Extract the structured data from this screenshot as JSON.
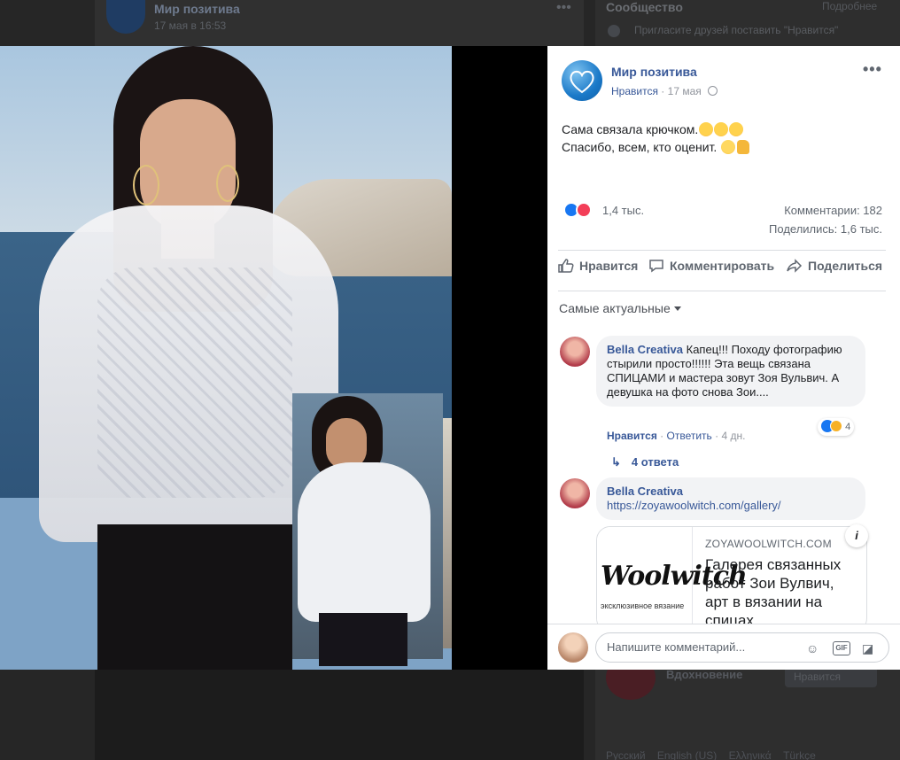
{
  "background": {
    "page_title": "Мир позитива",
    "page_date": "17 мая в 16:53",
    "sidebar_title": "Сообщество",
    "sidebar_more": "Подробнее",
    "invite_text": "Пригласите друзей поставить \"Нравится\"",
    "inspiration_label": "Вдохновение",
    "inspiration_like": "Нравится",
    "languages": [
      "Русский",
      "English (US)",
      "Ελληνικά",
      "Türkçe"
    ]
  },
  "post": {
    "page_name": "Мир позитива",
    "like_link": "Нравится",
    "separator": "·",
    "date": "17 мая",
    "text_line1": "Сама связала крючком.",
    "text_line2": "Спасибо, всем, кто оценит.",
    "reaction_count": "1,4 тыс.",
    "comments_count": "Комментарии: 182",
    "shares_count": "Поделились: 1,6 тыс.",
    "actions": {
      "like": "Нравится",
      "comment": "Комментировать",
      "share": "Поделиться"
    },
    "sort_label": "Самые актуальные"
  },
  "comments": [
    {
      "author": "Bella Creativa",
      "text": "Капец!!! Походу фотографию стырили просто!!!!!! Эта вещь связана СПИЦАМИ и мастера зовут Зоя Вульвич. А девушка на фото снова Зои....",
      "like": "Нравится",
      "reply": "Ответить",
      "time": "4 дн.",
      "reactions": "4",
      "replies": "4 ответа"
    },
    {
      "author": "Bella Creativa",
      "link": "https://zoyawoolwitch.com/gallery/",
      "card_domain": "ZOYAWOOLWITCH.COM",
      "card_title": "Галерея связанных работ Зои Вулвич, арт в вязании на спицах",
      "card_logo": "Woolwitch",
      "card_logo_sub": "эксклюзивное вязание"
    }
  ],
  "composer": {
    "placeholder": "Напишите комментарий..."
  },
  "colors": {
    "link": "#385898",
    "like_blue": "#1877f2",
    "love_red": "#f33e58"
  }
}
